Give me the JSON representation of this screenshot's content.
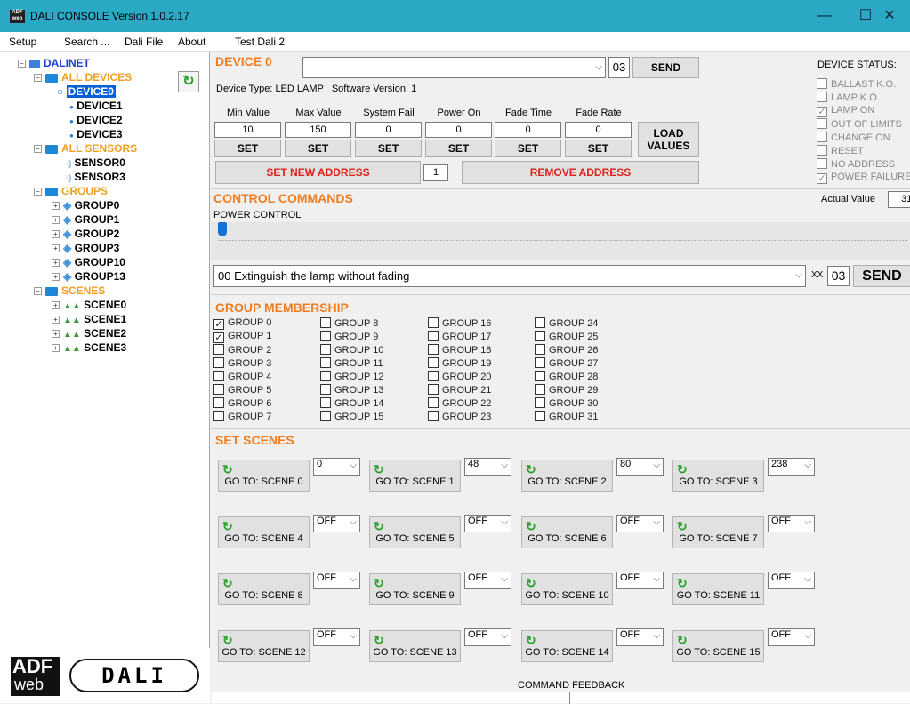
{
  "window": {
    "title": "DALI CONSOLE Version 1.0.2.17",
    "icon_text": "ADF web"
  },
  "menu": [
    "Setup",
    "Search ...",
    "Dali File",
    "About",
    "Test Dali 2"
  ],
  "tree": {
    "root": "DALINET",
    "all_devices": "ALL DEVICES",
    "devices": [
      "DEVICE0",
      "DEVICE1",
      "DEVICE2",
      "DEVICE3"
    ],
    "all_sensors": "ALL SENSORS",
    "sensors": [
      "SENSOR0",
      "SENSOR3"
    ],
    "groups_label": "GROUPS",
    "groups": [
      "GROUP0",
      "GROUP1",
      "GROUP2",
      "GROUP3",
      "GROUP10",
      "GROUP13"
    ],
    "scenes_label": "SCENES",
    "scenes": [
      "SCENE0",
      "SCENE1",
      "SCENE2",
      "SCENE3"
    ]
  },
  "logo": {
    "adf": "ADF",
    "web": "web",
    "dali": "DALI"
  },
  "device": {
    "title": "DEVICE 0",
    "address": "03",
    "send": "SEND",
    "type_line": "Device Type: LED LAMP   Software Version: 1",
    "params": [
      {
        "label": "Min Value",
        "value": "10"
      },
      {
        "label": "Max Value",
        "value": "150"
      },
      {
        "label": "System Fail",
        "value": "0"
      },
      {
        "label": "Power On",
        "value": "0"
      },
      {
        "label": "Fade Time",
        "value": "0"
      },
      {
        "label": "Fade Rate",
        "value": "0"
      }
    ],
    "set": "SET",
    "load_values": [
      "LOAD",
      "VALUES"
    ],
    "set_new_address": "SET NEW ADDRESS",
    "new_address_value": "1",
    "remove_address": "REMOVE ADDRESS"
  },
  "status": {
    "title": "DEVICE STATUS:",
    "items": [
      {
        "label": "BALLAST K.O.",
        "checked": false
      },
      {
        "label": "LAMP K.O.",
        "checked": false
      },
      {
        "label": "LAMP ON",
        "checked": true
      },
      {
        "label": "OUT OF LIMITS",
        "checked": false
      },
      {
        "label": "CHANGE ON",
        "checked": false
      },
      {
        "label": "RESET",
        "checked": false
      },
      {
        "label": "NO ADDRESS",
        "checked": false
      },
      {
        "label": "POWER FAILURE",
        "checked": true
      }
    ]
  },
  "control": {
    "title": "CONTROL COMMANDS",
    "actual_label": "Actual Value",
    "actual_value": "31",
    "power_label": "POWER CONTROL",
    "slider_level": 0.0,
    "command": "00 Extinguish the lamp without fading",
    "xx": "XX",
    "address": "03",
    "send": "SEND"
  },
  "membership": {
    "title": "GROUP MEMBERSHIP",
    "groups": [
      {
        "label": "GROUP 0",
        "checked": true
      },
      {
        "label": "GROUP 1",
        "checked": true
      },
      {
        "label": "GROUP 2",
        "checked": false
      },
      {
        "label": "GROUP 3",
        "checked": false
      },
      {
        "label": "GROUP 4",
        "checked": false
      },
      {
        "label": "GROUP 5",
        "checked": false
      },
      {
        "label": "GROUP 6",
        "checked": false
      },
      {
        "label": "GROUP 7",
        "checked": false
      },
      {
        "label": "GROUP 8",
        "checked": false
      },
      {
        "label": "GROUP 9",
        "checked": false
      },
      {
        "label": "GROUP 10",
        "checked": false
      },
      {
        "label": "GROUP 11",
        "checked": false
      },
      {
        "label": "GROUP 12",
        "checked": false
      },
      {
        "label": "GROUP 13",
        "checked": false
      },
      {
        "label": "GROUP 14",
        "checked": false
      },
      {
        "label": "GROUP 15",
        "checked": false
      },
      {
        "label": "GROUP 16",
        "checked": false
      },
      {
        "label": "GROUP 17",
        "checked": false
      },
      {
        "label": "GROUP 18",
        "checked": false
      },
      {
        "label": "GROUP 19",
        "checked": false
      },
      {
        "label": "GROUP 20",
        "checked": false
      },
      {
        "label": "GROUP 21",
        "checked": false
      },
      {
        "label": "GROUP 22",
        "checked": false
      },
      {
        "label": "GROUP 23",
        "checked": false
      },
      {
        "label": "GROUP 24",
        "checked": false
      },
      {
        "label": "GROUP 25",
        "checked": false
      },
      {
        "label": "GROUP 26",
        "checked": false
      },
      {
        "label": "GROUP 27",
        "checked": false
      },
      {
        "label": "GROUP 28",
        "checked": false
      },
      {
        "label": "GROUP 29",
        "checked": false
      },
      {
        "label": "GROUP 30",
        "checked": false
      },
      {
        "label": "GROUP 31",
        "checked": false
      }
    ]
  },
  "scenes": {
    "title": "SET SCENES",
    "items": [
      {
        "label": "GO TO: SCENE 0",
        "value": "0"
      },
      {
        "label": "GO TO: SCENE 1",
        "value": "48"
      },
      {
        "label": "GO TO: SCENE 2",
        "value": "80"
      },
      {
        "label": "GO TO: SCENE 3",
        "value": "238"
      },
      {
        "label": "GO TO: SCENE 4",
        "value": "OFF"
      },
      {
        "label": "GO TO: SCENE 5",
        "value": "OFF"
      },
      {
        "label": "GO TO: SCENE 6",
        "value": "OFF"
      },
      {
        "label": "GO TO: SCENE 7",
        "value": "OFF"
      },
      {
        "label": "GO TO: SCENE 8",
        "value": "OFF"
      },
      {
        "label": "GO TO: SCENE 9",
        "value": "OFF"
      },
      {
        "label": "GO TO: SCENE 10",
        "value": "OFF"
      },
      {
        "label": "GO TO: SCENE 11",
        "value": "OFF"
      },
      {
        "label": "GO TO: SCENE 12",
        "value": "OFF"
      },
      {
        "label": "GO TO: SCENE 13",
        "value": "OFF"
      },
      {
        "label": "GO TO: SCENE 14",
        "value": "OFF"
      },
      {
        "label": "GO TO: SCENE 15",
        "value": "OFF"
      }
    ]
  },
  "feedback": {
    "title": "COMMAND FEEDBACK"
  },
  "colors": {
    "titlebar": "#2aa8c4",
    "section": "#f07d20",
    "command_red": "#e0201a",
    "tree_orange": "#f0a020"
  }
}
